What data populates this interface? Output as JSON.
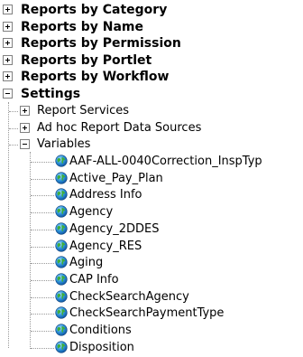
{
  "tree": {
    "categories": [
      {
        "label": "Reports by Category",
        "state": "collapsed"
      },
      {
        "label": "Reports by Name",
        "state": "collapsed"
      },
      {
        "label": "Reports by Permission",
        "state": "collapsed"
      },
      {
        "label": "Reports by Portlet",
        "state": "collapsed"
      },
      {
        "label": "Reports by Workflow",
        "state": "collapsed"
      },
      {
        "label": "Settings",
        "state": "expanded"
      }
    ],
    "settings_children": [
      {
        "label": "Report Services",
        "state": "collapsed"
      },
      {
        "label": "Ad hoc Report Data Sources",
        "state": "collapsed"
      },
      {
        "label": "Variables",
        "state": "expanded"
      }
    ],
    "variables": [
      "AAF-ALL-0040Correction_InspTyp",
      "Active_Pay_Plan",
      "Address Info",
      "Agency",
      "Agency_2DDES",
      "Agency_RES",
      "Aging",
      "CAP Info",
      "CheckSearchAgency",
      "CheckSearchPaymentType",
      "Conditions",
      "Disposition"
    ],
    "icons": {
      "expand": "plus-box-icon",
      "collapse": "minus-box-icon",
      "variable": "globe-icon"
    }
  }
}
